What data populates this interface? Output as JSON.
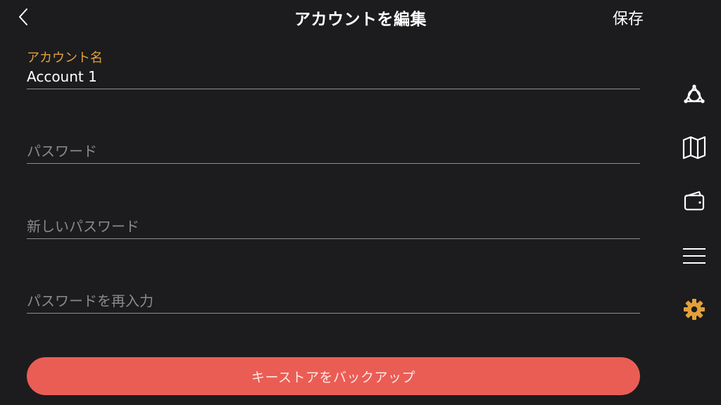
{
  "header": {
    "title": "アカウントを編集",
    "save_label": "保存"
  },
  "form": {
    "account_name": {
      "label": "アカウント名",
      "value": "Account 1"
    },
    "password": {
      "placeholder": "パスワード"
    },
    "new_password": {
      "placeholder": "新しいパスワード"
    },
    "confirm_password": {
      "placeholder": "パスワードを再入力"
    }
  },
  "backup_button_label": "キーストアをバックアップ",
  "sidenav": {
    "items": [
      {
        "icon": "triangle-node-icon",
        "active": false
      },
      {
        "icon": "map-icon",
        "active": false
      },
      {
        "icon": "wallet-icon",
        "active": false
      },
      {
        "icon": "menu-icon",
        "active": false
      },
      {
        "icon": "gear-icon",
        "active": true
      }
    ]
  },
  "colors": {
    "background": "#1c1c1e",
    "accent": "#e3a03a",
    "primary_button": "#ea5d55",
    "divider": "#8e8e93",
    "placeholder": "#8a8a8e"
  }
}
